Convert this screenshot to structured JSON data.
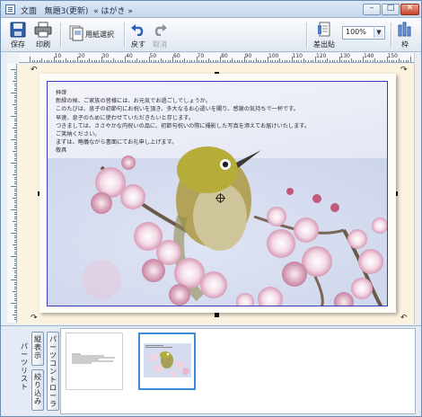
{
  "window": {
    "app_title": "文面",
    "doc_title": "無題3(更新)",
    "doc_type": "« はがき »",
    "min_glyph": "–",
    "max_glyph": "□",
    "close_glyph": "✕"
  },
  "toolbar": {
    "save": "保存",
    "print": "印刷",
    "paper_select": "用紙選択",
    "undo": "戻す",
    "redo": "取消",
    "sender": "差出貼",
    "zoom": "100%",
    "frame": "枠"
  },
  "ruler": {
    "h_labels": [
      "10",
      "20",
      "30",
      "40",
      "50",
      "60",
      "70",
      "80",
      "90",
      "100",
      "110",
      "120",
      "130",
      "140",
      "150"
    ],
    "v_labels": [
      "10",
      "20",
      "30",
      "40",
      "50",
      "60",
      "70",
      "80",
      "90",
      "100"
    ]
  },
  "letter": {
    "lines": [
      "拝啓",
      "新緑の候、ご家族の皆様には、お元気でお過ごしでしょうか。",
      "このたびは、息子の初節句にお祝いを頂き、多大なるお心遣いを賜り、感謝の気持ちで一杯です。",
      "早速、息子のために使わせていただきたいと存じます。",
      "つきましては、ささやかな内祝いの品に、初節句祝いの際に撮影した写真を添えてお届けいたします。",
      "ご笑納ください。",
      "まずは、略儀ながら書面にてお礼申し上げます。",
      "敬具"
    ]
  },
  "bottom": {
    "side_label": "パーツリスト",
    "vertical_label": "縦表示",
    "narrow_button": "絞り込み",
    "parts_control": "パーツコントローラ"
  },
  "colors": {
    "accent": "#3d8bd8",
    "canvas_bg": "#fbf2df",
    "frame_line": "#3a3ab8"
  },
  "icons": [
    "save-icon",
    "print-icon",
    "paper-select-icon",
    "undo-icon",
    "redo-icon",
    "sender-icon",
    "frame-icon"
  ]
}
